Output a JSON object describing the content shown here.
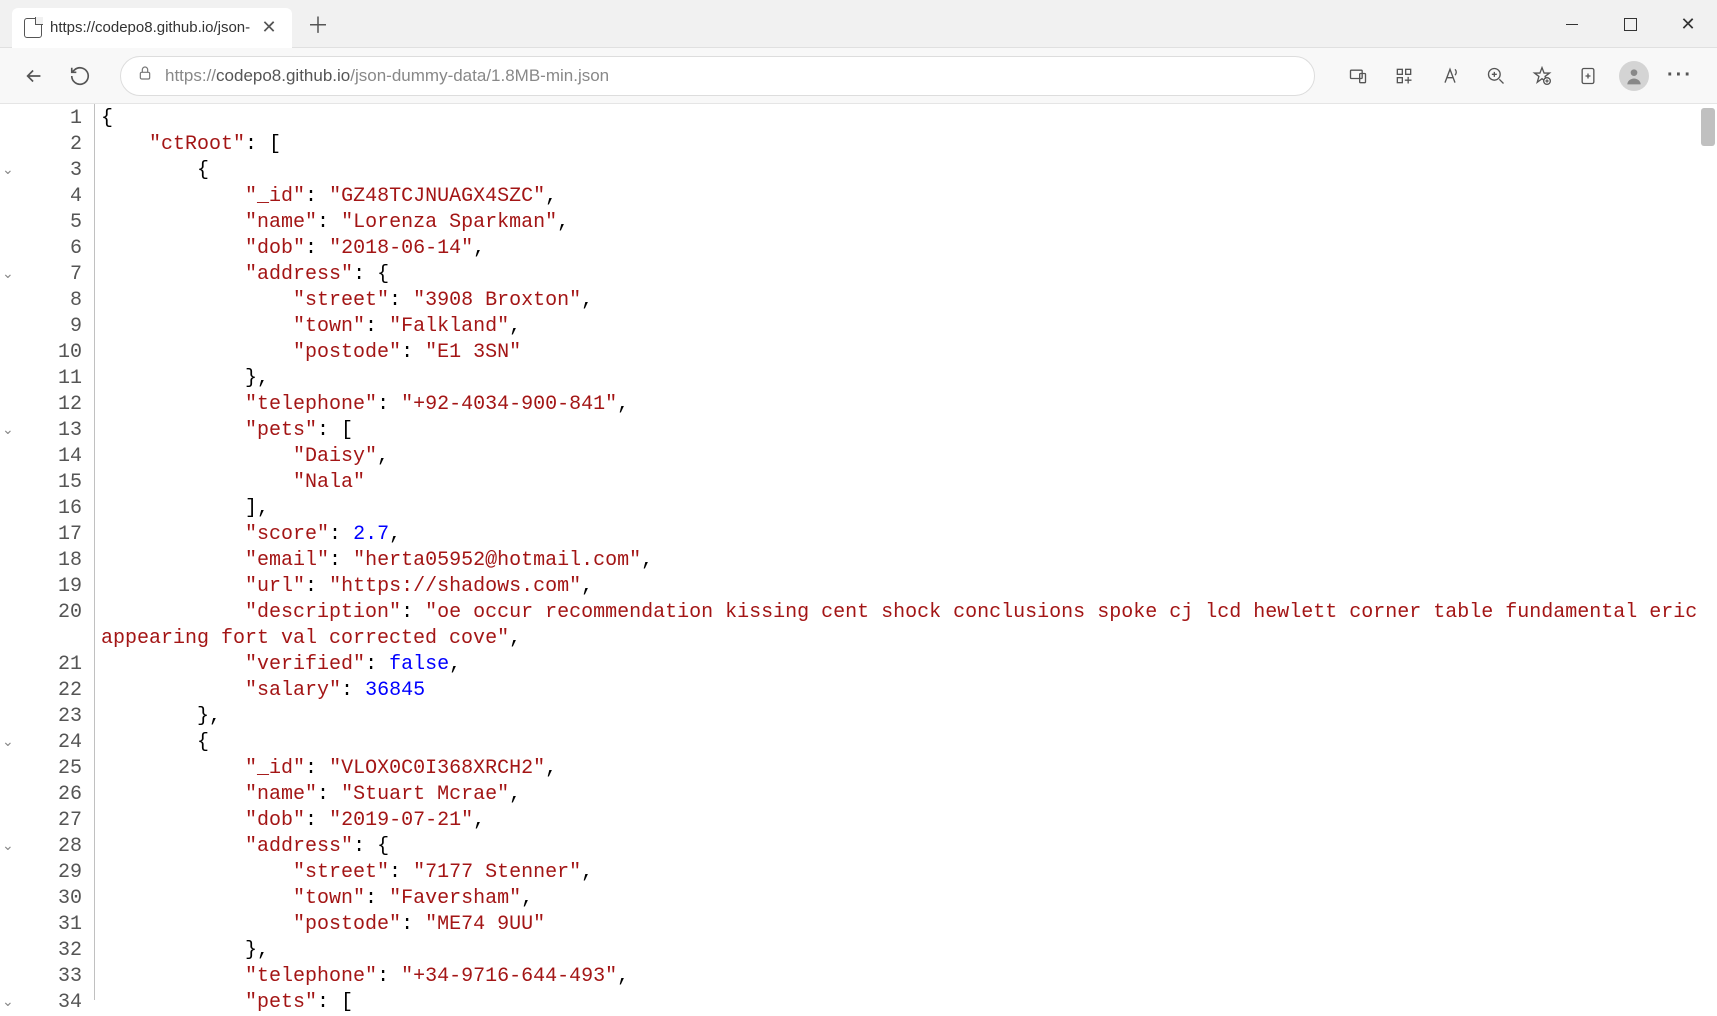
{
  "tab": {
    "title": "https://codepo8.github.io/json-"
  },
  "url": {
    "protocol": "https://",
    "host": "codepo8.github.io",
    "path": "/json-dummy-data/1.8MB-min.json"
  },
  "fold_markers": [
    3,
    7,
    13,
    24,
    28,
    34
  ],
  "json_tokens": [
    [
      {
        "t": "pun",
        "v": "{"
      }
    ],
    [
      {
        "t": "pun",
        "v": "    "
      },
      {
        "t": "key",
        "v": "\"ctRoot\""
      },
      {
        "t": "pun",
        "v": ": ["
      }
    ],
    [
      {
        "t": "pun",
        "v": "        {"
      }
    ],
    [
      {
        "t": "pun",
        "v": "            "
      },
      {
        "t": "key",
        "v": "\"_id\""
      },
      {
        "t": "pun",
        "v": ": "
      },
      {
        "t": "str",
        "v": "\"GZ48TCJNUAGX4SZC\""
      },
      {
        "t": "pun",
        "v": ","
      }
    ],
    [
      {
        "t": "pun",
        "v": "            "
      },
      {
        "t": "key",
        "v": "\"name\""
      },
      {
        "t": "pun",
        "v": ": "
      },
      {
        "t": "str",
        "v": "\"Lorenza Sparkman\""
      },
      {
        "t": "pun",
        "v": ","
      }
    ],
    [
      {
        "t": "pun",
        "v": "            "
      },
      {
        "t": "key",
        "v": "\"dob\""
      },
      {
        "t": "pun",
        "v": ": "
      },
      {
        "t": "str",
        "v": "\"2018-06-14\""
      },
      {
        "t": "pun",
        "v": ","
      }
    ],
    [
      {
        "t": "pun",
        "v": "            "
      },
      {
        "t": "key",
        "v": "\"address\""
      },
      {
        "t": "pun",
        "v": ": {"
      }
    ],
    [
      {
        "t": "pun",
        "v": "                "
      },
      {
        "t": "key",
        "v": "\"street\""
      },
      {
        "t": "pun",
        "v": ": "
      },
      {
        "t": "str",
        "v": "\"3908 Broxton\""
      },
      {
        "t": "pun",
        "v": ","
      }
    ],
    [
      {
        "t": "pun",
        "v": "                "
      },
      {
        "t": "key",
        "v": "\"town\""
      },
      {
        "t": "pun",
        "v": ": "
      },
      {
        "t": "str",
        "v": "\"Falkland\""
      },
      {
        "t": "pun",
        "v": ","
      }
    ],
    [
      {
        "t": "pun",
        "v": "                "
      },
      {
        "t": "key",
        "v": "\"postode\""
      },
      {
        "t": "pun",
        "v": ": "
      },
      {
        "t": "str",
        "v": "\"E1 3SN\""
      }
    ],
    [
      {
        "t": "pun",
        "v": "            },"
      }
    ],
    [
      {
        "t": "pun",
        "v": "            "
      },
      {
        "t": "key",
        "v": "\"telephone\""
      },
      {
        "t": "pun",
        "v": ": "
      },
      {
        "t": "str",
        "v": "\"+92-4034-900-841\""
      },
      {
        "t": "pun",
        "v": ","
      }
    ],
    [
      {
        "t": "pun",
        "v": "            "
      },
      {
        "t": "key",
        "v": "\"pets\""
      },
      {
        "t": "pun",
        "v": ": ["
      }
    ],
    [
      {
        "t": "pun",
        "v": "                "
      },
      {
        "t": "str",
        "v": "\"Daisy\""
      },
      {
        "t": "pun",
        "v": ","
      }
    ],
    [
      {
        "t": "pun",
        "v": "                "
      },
      {
        "t": "str",
        "v": "\"Nala\""
      }
    ],
    [
      {
        "t": "pun",
        "v": "            ],"
      }
    ],
    [
      {
        "t": "pun",
        "v": "            "
      },
      {
        "t": "key",
        "v": "\"score\""
      },
      {
        "t": "pun",
        "v": ": "
      },
      {
        "t": "num",
        "v": "2.7"
      },
      {
        "t": "pun",
        "v": ","
      }
    ],
    [
      {
        "t": "pun",
        "v": "            "
      },
      {
        "t": "key",
        "v": "\"email\""
      },
      {
        "t": "pun",
        "v": ": "
      },
      {
        "t": "str",
        "v": "\"herta05952@hotmail.com\""
      },
      {
        "t": "pun",
        "v": ","
      }
    ],
    [
      {
        "t": "pun",
        "v": "            "
      },
      {
        "t": "key",
        "v": "\"url\""
      },
      {
        "t": "pun",
        "v": ": "
      },
      {
        "t": "str",
        "v": "\"https://shadows.com\""
      },
      {
        "t": "pun",
        "v": ","
      }
    ],
    [
      {
        "t": "pun",
        "v": "            "
      },
      {
        "t": "key",
        "v": "\"description\""
      },
      {
        "t": "pun",
        "v": ": "
      },
      {
        "t": "str",
        "v": "\"oe occur recommendation kissing cent shock conclusions spoke cj lcd hewlett corner table fundamental eric appearing fort val corrected cove\""
      },
      {
        "t": "pun",
        "v": ","
      }
    ],
    [
      {
        "t": "pun",
        "v": "            "
      },
      {
        "t": "key",
        "v": "\"verified\""
      },
      {
        "t": "pun",
        "v": ": "
      },
      {
        "t": "bool",
        "v": "false"
      },
      {
        "t": "pun",
        "v": ","
      }
    ],
    [
      {
        "t": "pun",
        "v": "            "
      },
      {
        "t": "key",
        "v": "\"salary\""
      },
      {
        "t": "pun",
        "v": ": "
      },
      {
        "t": "num",
        "v": "36845"
      }
    ],
    [
      {
        "t": "pun",
        "v": "        },"
      }
    ],
    [
      {
        "t": "pun",
        "v": "        {"
      }
    ],
    [
      {
        "t": "pun",
        "v": "            "
      },
      {
        "t": "key",
        "v": "\"_id\""
      },
      {
        "t": "pun",
        "v": ": "
      },
      {
        "t": "str",
        "v": "\"VLOX0C0I368XRCH2\""
      },
      {
        "t": "pun",
        "v": ","
      }
    ],
    [
      {
        "t": "pun",
        "v": "            "
      },
      {
        "t": "key",
        "v": "\"name\""
      },
      {
        "t": "pun",
        "v": ": "
      },
      {
        "t": "str",
        "v": "\"Stuart Mcrae\""
      },
      {
        "t": "pun",
        "v": ","
      }
    ],
    [
      {
        "t": "pun",
        "v": "            "
      },
      {
        "t": "key",
        "v": "\"dob\""
      },
      {
        "t": "pun",
        "v": ": "
      },
      {
        "t": "str",
        "v": "\"2019-07-21\""
      },
      {
        "t": "pun",
        "v": ","
      }
    ],
    [
      {
        "t": "pun",
        "v": "            "
      },
      {
        "t": "key",
        "v": "\"address\""
      },
      {
        "t": "pun",
        "v": ": {"
      }
    ],
    [
      {
        "t": "pun",
        "v": "                "
      },
      {
        "t": "key",
        "v": "\"street\""
      },
      {
        "t": "pun",
        "v": ": "
      },
      {
        "t": "str",
        "v": "\"7177 Stenner\""
      },
      {
        "t": "pun",
        "v": ","
      }
    ],
    [
      {
        "t": "pun",
        "v": "                "
      },
      {
        "t": "key",
        "v": "\"town\""
      },
      {
        "t": "pun",
        "v": ": "
      },
      {
        "t": "str",
        "v": "\"Faversham\""
      },
      {
        "t": "pun",
        "v": ","
      }
    ],
    [
      {
        "t": "pun",
        "v": "                "
      },
      {
        "t": "key",
        "v": "\"postode\""
      },
      {
        "t": "pun",
        "v": ": "
      },
      {
        "t": "str",
        "v": "\"ME74 9UU\""
      }
    ],
    [
      {
        "t": "pun",
        "v": "            },"
      }
    ],
    [
      {
        "t": "pun",
        "v": "            "
      },
      {
        "t": "key",
        "v": "\"telephone\""
      },
      {
        "t": "pun",
        "v": ": "
      },
      {
        "t": "str",
        "v": "\"+34-9716-644-493\""
      },
      {
        "t": "pun",
        "v": ","
      }
    ],
    [
      {
        "t": "pun",
        "v": "            "
      },
      {
        "t": "key",
        "v": "\"pets\""
      },
      {
        "t": "pun",
        "v": ": ["
      }
    ]
  ]
}
